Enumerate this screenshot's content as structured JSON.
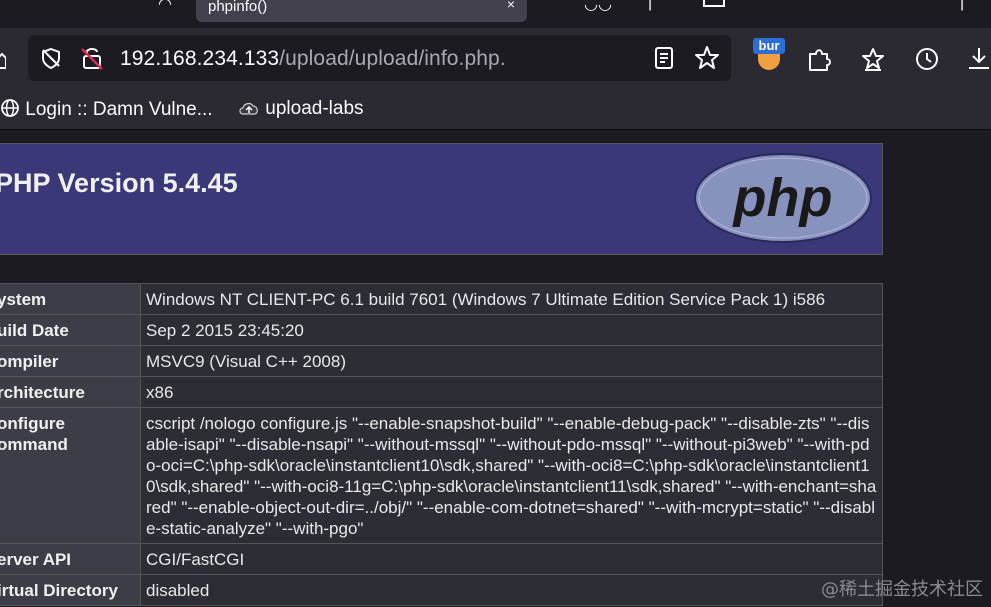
{
  "tab": {
    "title": "phpinfo()",
    "close_glyph": "×"
  },
  "address_bar": {
    "host": "192.168.234.133",
    "path": "/upload/upload/info.php."
  },
  "extension": {
    "badge": "bur"
  },
  "bookmarks": [
    {
      "label": "Login :: Damn Vulne..."
    },
    {
      "label": "upload-labs"
    }
  ],
  "phpinfo": {
    "version_title": "PHP Version 5.4.45",
    "logo_text": "php",
    "rows": [
      {
        "key": "ystem",
        "value": "Windows NT CLIENT-PC 6.1 build 7601 (Windows 7 Ultimate Edition Service Pack 1) i586"
      },
      {
        "key": "uild Date",
        "value": "Sep 2 2015 23:45:20"
      },
      {
        "key": "ompiler",
        "value": "MSVC9 (Visual C++ 2008)"
      },
      {
        "key": "rchitecture",
        "value": "x86"
      },
      {
        "key": "onfigure\nommand",
        "value": "cscript /nologo configure.js \"--enable-snapshot-build\" \"--enable-debug-pack\" \"--disable-zts\" \"--disable-isapi\" \"--disable-nsapi\" \"--without-mssql\" \"--without-pdo-mssql\" \"--without-pi3web\" \"--with-pdo-oci=C:\\php-sdk\\oracle\\instantclient10\\sdk,shared\" \"--with-oci8=C:\\php-sdk\\oracle\\instantclient10\\sdk,shared\" \"--with-oci8-11g=C:\\php-sdk\\oracle\\instantclient11\\sdk,shared\" \"--with-enchant=shared\" \"--enable-object-out-dir=../obj/\" \"--enable-com-dotnet=shared\" \"--with-mcrypt=static\" \"--disable-static-analyze\" \"--with-pgo\""
      },
      {
        "key": "erver API",
        "value": "CGI/FastCGI"
      },
      {
        "key": "irtual Directory",
        "value": "disabled"
      }
    ]
  },
  "watermark": "@稀土掘金技术社区"
}
